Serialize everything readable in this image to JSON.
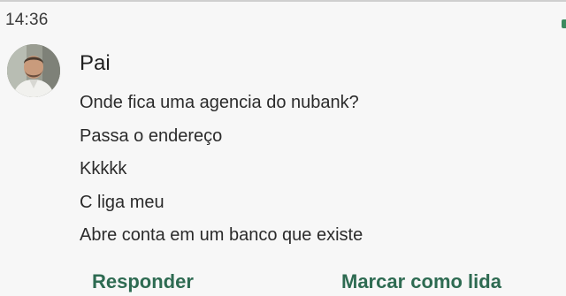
{
  "notification": {
    "time": "14:36",
    "sender": "Pai",
    "messages": [
      "Onde fica uma agencia do nubank?",
      "Passa o endereço",
      "Kkkkk",
      "C liga meu",
      "Abre conta em um banco que existe"
    ],
    "actions": {
      "reply_label": "Responder",
      "mark_read_label": "Marcar como lida"
    }
  },
  "colors": {
    "background": "#f7f7f7",
    "action_text": "#2e6b52",
    "accent": "#3c8a5f"
  }
}
